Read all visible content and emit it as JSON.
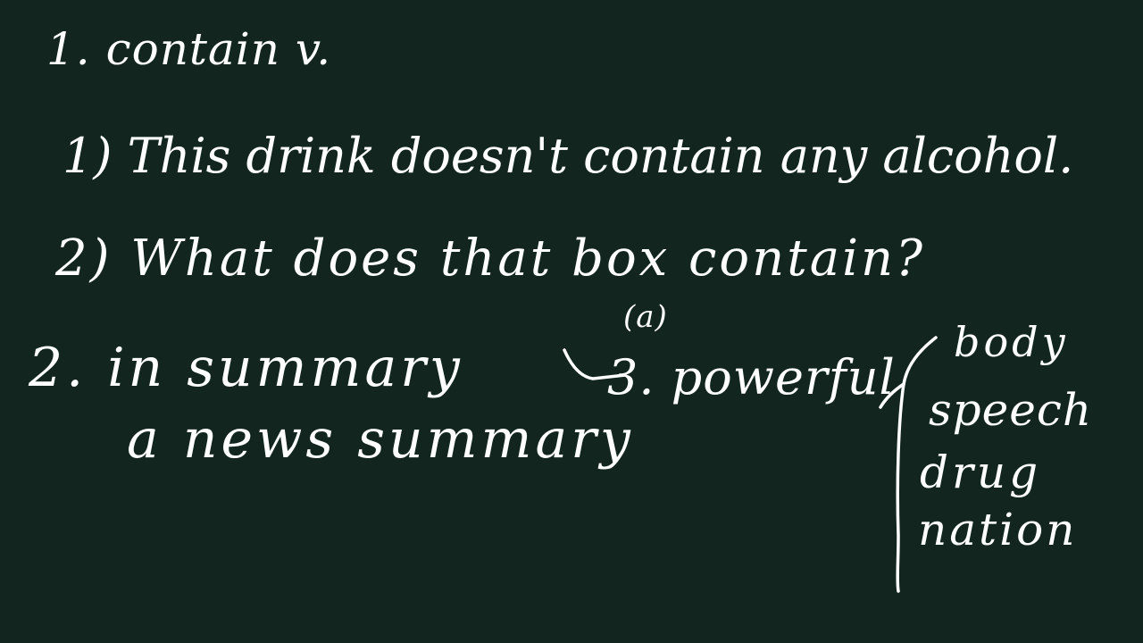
{
  "board": {
    "background_color": "#12261f",
    "ink_color": "#ffffff"
  },
  "item1": {
    "heading": "1. contain v.",
    "example1": "1) This drink doesn't contain any alcohol.",
    "example2": "2) What does that box contain?"
  },
  "item2": {
    "heading": "2. in summary",
    "phrase": "a news summary"
  },
  "item3": {
    "pos": "(a)",
    "heading": "3. powerful",
    "collocations": [
      "body",
      "speech",
      "drug",
      "nation"
    ]
  }
}
